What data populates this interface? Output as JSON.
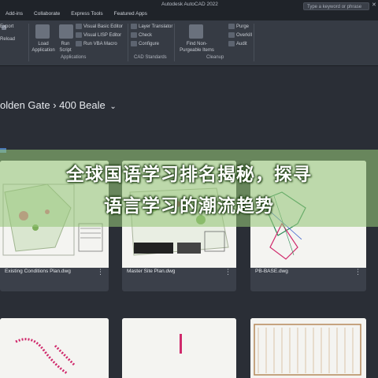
{
  "window": {
    "title": "Autodesk AutoCAD 2022",
    "search_placeholder": "Type a keyword or phrase"
  },
  "menu": [
    "Add-ins",
    "Collaborate",
    "Express Tools",
    "Featured Apps"
  ],
  "ribbon": {
    "left_items": [
      "Export",
      "Load",
      "Reload",
      "Run"
    ],
    "applications": {
      "label": "Applications",
      "load_application": "Load Application",
      "run_script": "Run Script",
      "items": [
        "Visual Basic Editor",
        "Visual LISP Editor",
        "Run VBA Macro"
      ]
    },
    "cad_standards": {
      "label": "CAD Standards",
      "items": [
        "Layer Translator",
        "Check",
        "Configure"
      ]
    },
    "cleanup": {
      "label": "Cleanup",
      "find": "Find Non-Purgeable Items",
      "items": [
        "Purge",
        "Overkill",
        "Audit"
      ]
    }
  },
  "browser": {
    "breadcrumb": "olden Gate  ›  400 Beale",
    "chevron": "⌄",
    "files": [
      {
        "name": "Existing Conditions Plan.dwg"
      },
      {
        "name": "Master Site Plan.dwg"
      },
      {
        "name": "PB-BASE.dwg"
      }
    ],
    "more_glyph": "⋮"
  },
  "overlay": {
    "line1": "全球国语学习排名揭秘，探寻",
    "line2": "语言学习的潮流趋势"
  }
}
